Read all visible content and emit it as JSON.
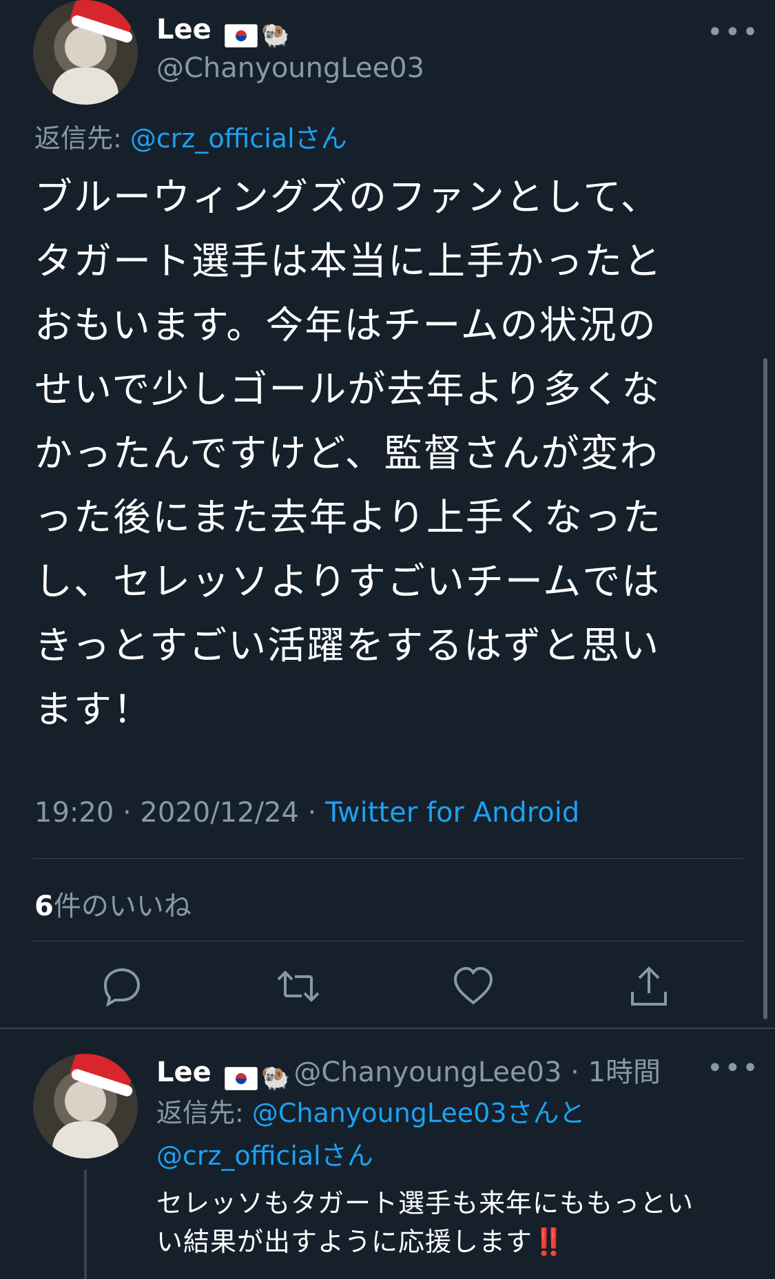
{
  "tweet": {
    "author": {
      "name": "Lee",
      "handle": "@ChanyoungLee03",
      "emoji": "🐏"
    },
    "reply_to": {
      "prefix": "返信先:",
      "mention": "@crz_official",
      "suffix": "さん"
    },
    "lines": [
      "ブルーウィングズのファンとして、",
      "タガート選手は本当に上手かったと",
      "おもいます。今年はチームの状況の",
      "せいで少しゴールが去年より多くな",
      "かったんですけど、監督さんが変わ",
      "った後にまた去年より上手くなった",
      "し、セレッソよりすごいチームでは",
      "きっとすごい活躍をするはずと思い",
      "ます！"
    ],
    "time": "19:20 · 2020/12/24 · ",
    "source": "Twitter for Android",
    "likes_count": "6",
    "likes_label": "件のいいね",
    "more": "•••"
  },
  "reply": {
    "author": {
      "name": "Lee",
      "handle": "@ChanyoungLee03",
      "emoji": "🐏",
      "time": " · 1時間"
    },
    "reply_to": {
      "prefix": "返信先: ",
      "mention1": "@ChanyoungLee03",
      "mid": "さんと",
      "mention2": "@crz_official",
      "suffix": "さん"
    },
    "lines": [
      "セレッソもタガート選手も来年にももっとい",
      "い結果が出すように応援します‼️"
    ],
    "more": "•••"
  },
  "icons": {
    "reply": "reply-icon",
    "retweet": "retweet-icon",
    "like": "heart-icon",
    "share": "share-icon"
  }
}
